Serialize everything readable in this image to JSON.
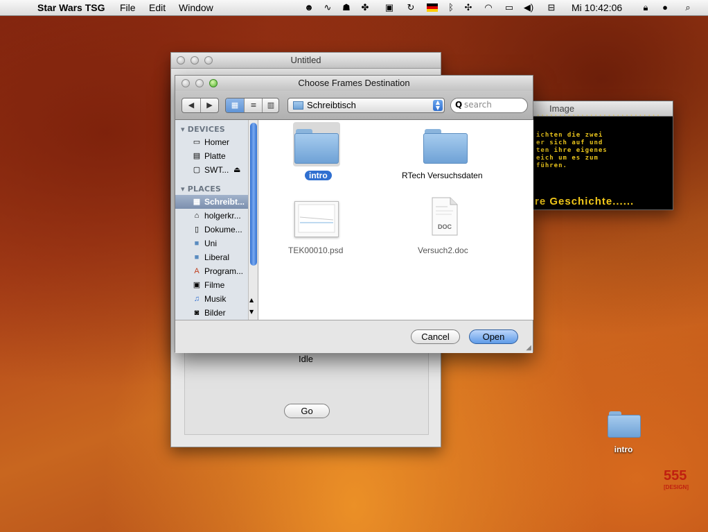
{
  "menubar": {
    "apple_icon": "apple-icon",
    "app_name": "Star Wars TSG",
    "menus": [
      "File",
      "Edit",
      "Window"
    ],
    "clock": "Mi 10:42:06"
  },
  "back_window": {
    "title": "Untitled",
    "status": "Idle",
    "go_label": "Go"
  },
  "image_window": {
    "title": "Image",
    "crawl_lines": [
      "............................",
      "ichten die zwei",
      "er sich auf und",
      "ten ihre eigenes",
      "eich um es zum",
      "führen."
    ],
    "crawl_big": "re Geschichte......",
    "crawl_color": "#f2c81a"
  },
  "dialog": {
    "title": "Choose Frames Destination",
    "location": "Schreibtisch",
    "search_placeholder": "search",
    "sidebar": {
      "devices_header": "DEVICES",
      "devices": [
        {
          "label": "Homer",
          "icon": "computer-icon"
        },
        {
          "label": "Platte",
          "icon": "harddisk-icon"
        },
        {
          "label": "SWT...",
          "icon": "drive-icon"
        }
      ],
      "places_header": "PLACES",
      "places": [
        {
          "label": "Schreibt...",
          "icon": "desktop-icon"
        },
        {
          "label": "holgerkr...",
          "icon": "home-icon"
        },
        {
          "label": "Dokume...",
          "icon": "documents-icon"
        },
        {
          "label": "Uni",
          "icon": "folder-icon"
        },
        {
          "label": "Liberal",
          "icon": "folder-icon"
        },
        {
          "label": "Program...",
          "icon": "applications-icon"
        },
        {
          "label": "Filme",
          "icon": "movies-icon"
        },
        {
          "label": "Musik",
          "icon": "music-icon"
        },
        {
          "label": "Bilder",
          "icon": "pictures-icon"
        }
      ]
    },
    "files": [
      {
        "name": "intro",
        "kind": "folder",
        "selected": true
      },
      {
        "name": "RTech Versuchsdaten",
        "kind": "folder",
        "selected": false
      },
      {
        "name": "TEK00010.psd",
        "kind": "psd",
        "selected": false
      },
      {
        "name": "Versuch2.doc",
        "kind": "doc",
        "selected": false
      }
    ],
    "doc_badge": "DOC",
    "cancel_label": "Cancel",
    "open_label": "Open",
    "accent_color": "#2f6fd0"
  },
  "desktop": {
    "folder_label": "intro",
    "logo_text": "555",
    "logo_sub": "[DESIGN]"
  }
}
